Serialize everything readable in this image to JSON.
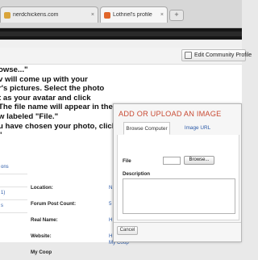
{
  "browser": {
    "tabs": [
      {
        "label": "nerdchickens.com",
        "favicon_color": "#d9a43a",
        "active": false
      },
      {
        "label": "Lothriel's profile",
        "favicon_color": "#e0662a",
        "active": true
      }
    ],
    "new_tab_label": "+",
    "tab_close": "×"
  },
  "toolbar": {
    "edit_profile_label": "Edit Community Profile"
  },
  "instructions": {
    "lines": [
      "owse...\"",
      "v will come up with your",
      "r's pictures. Select the photo",
      "t as your avatar and click",
      "The file name will appear in the",
      "w labeled \"File.\"",
      "u have chosen your photo, click",
      "\""
    ]
  },
  "sidebar": {
    "links": [
      "ons",
      "",
      "1)",
      "s"
    ]
  },
  "profile": {
    "fields": [
      {
        "label": "Location:",
        "value": "N"
      },
      {
        "label": "Forum Post Count:",
        "value": "5"
      },
      {
        "label": "Real Name:",
        "value": "H"
      },
      {
        "label": "Website:",
        "value": "H"
      },
      {
        "label": "My Coop",
        "value": "My Coop"
      }
    ]
  },
  "modal": {
    "title": "ADD OR UPLOAD AN IMAGE",
    "tabs": [
      "Browse Computer",
      "Image URL"
    ],
    "file_label": "File",
    "browse_label": "Browse...",
    "description_label": "Description",
    "cancel_label": "Cancel"
  }
}
